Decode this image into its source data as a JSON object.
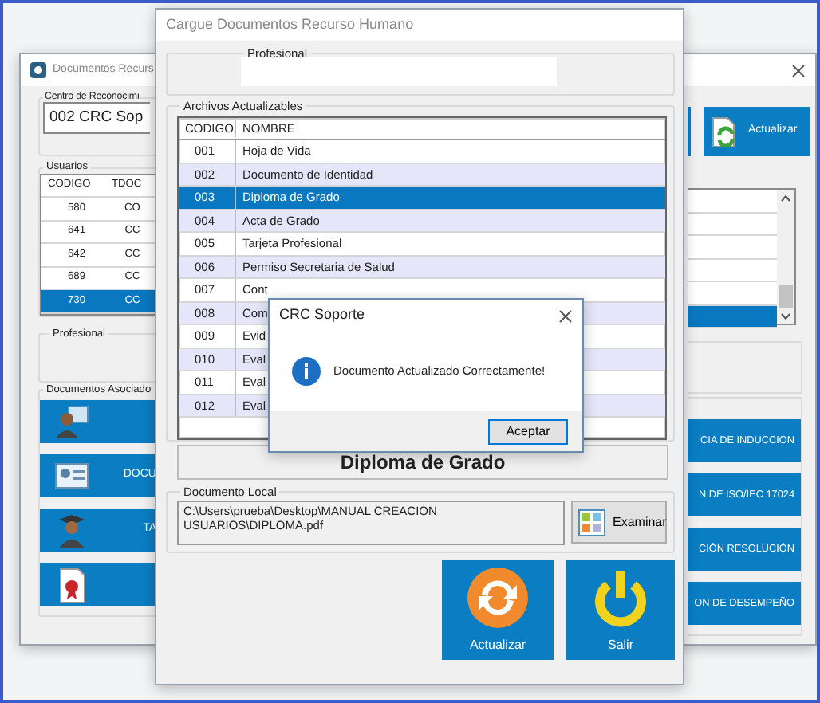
{
  "back_window": {
    "title": "Documentos Recurs",
    "center_label": "Centro de Reconocimi",
    "center_value": "002 CRC Sop",
    "actualizar_button": "Actualizar",
    "users_label": "Usuarios",
    "users_table": {
      "columns": [
        "CODIGO",
        "TDOC"
      ],
      "rows": [
        {
          "cells": [
            "580",
            "CO"
          ],
          "selected": false
        },
        {
          "cells": [
            "641",
            "CC"
          ],
          "selected": false
        },
        {
          "cells": [
            "642",
            "CC"
          ],
          "selected": false
        },
        {
          "cells": [
            "689",
            "CC"
          ],
          "selected": false
        },
        {
          "cells": [
            "730",
            "CC"
          ],
          "selected": true
        }
      ]
    },
    "profesional_label": "Profesional",
    "documents_label": "Documentos Asociado",
    "document_buttons": [
      {
        "kind": "person",
        "right_text": "CIA DE INDUCCION"
      },
      {
        "kind": "card",
        "left_text": "DOCU",
        "right_text": "N DE ISO/IEC 17024"
      },
      {
        "kind": "graduate",
        "left_text": "TA",
        "right_text": "CIÓN RESOLUCIÓN"
      },
      {
        "kind": "diploma",
        "right_text": "ON DE DESEMPEÑO"
      }
    ]
  },
  "front_window": {
    "title": "Cargue Documentos Recurso Humano",
    "profesional_label": "Profesional",
    "archivos_label": "Archivos Actualizables",
    "files_table": {
      "columns": [
        "CODIGO",
        "NOMBRE"
      ],
      "rows": [
        {
          "code": "001",
          "name": "Hoja de Vida",
          "selected": false
        },
        {
          "code": "002",
          "name": "Documento de Identidad",
          "selected": false
        },
        {
          "code": "003",
          "name": "Diploma de Grado",
          "selected": true
        },
        {
          "code": "004",
          "name": "Acta de Grado",
          "selected": false
        },
        {
          "code": "005",
          "name": "Tarjeta Profesional",
          "selected": false
        },
        {
          "code": "006",
          "name": "Permiso Secretaria de Salud",
          "selected": false
        },
        {
          "code": "007",
          "name": "Cont",
          "selected": false
        },
        {
          "code": "008",
          "name": "Com",
          "selected": false
        },
        {
          "code": "009",
          "name": "Evid",
          "selected": false
        },
        {
          "code": "010",
          "name": "Eval",
          "selected": false
        },
        {
          "code": "011",
          "name": "Eval",
          "selected": false
        },
        {
          "code": "012",
          "name": "Eval",
          "selected": false
        }
      ]
    },
    "selected_document": "Diploma de Grado",
    "local_label": "Documento Local",
    "local_path": "C:\\Users\\prueba\\Desktop\\MANUAL CREACION USUARIOS\\DIPLOMA.pdf",
    "examinar_button": "Examinar",
    "actualizar_button": "Actualizar",
    "salir_button": "Salir"
  },
  "dialog": {
    "title": "CRC Soporte",
    "message": "Documento Actualizado Correctamente!",
    "ok_button": "Aceptar"
  }
}
